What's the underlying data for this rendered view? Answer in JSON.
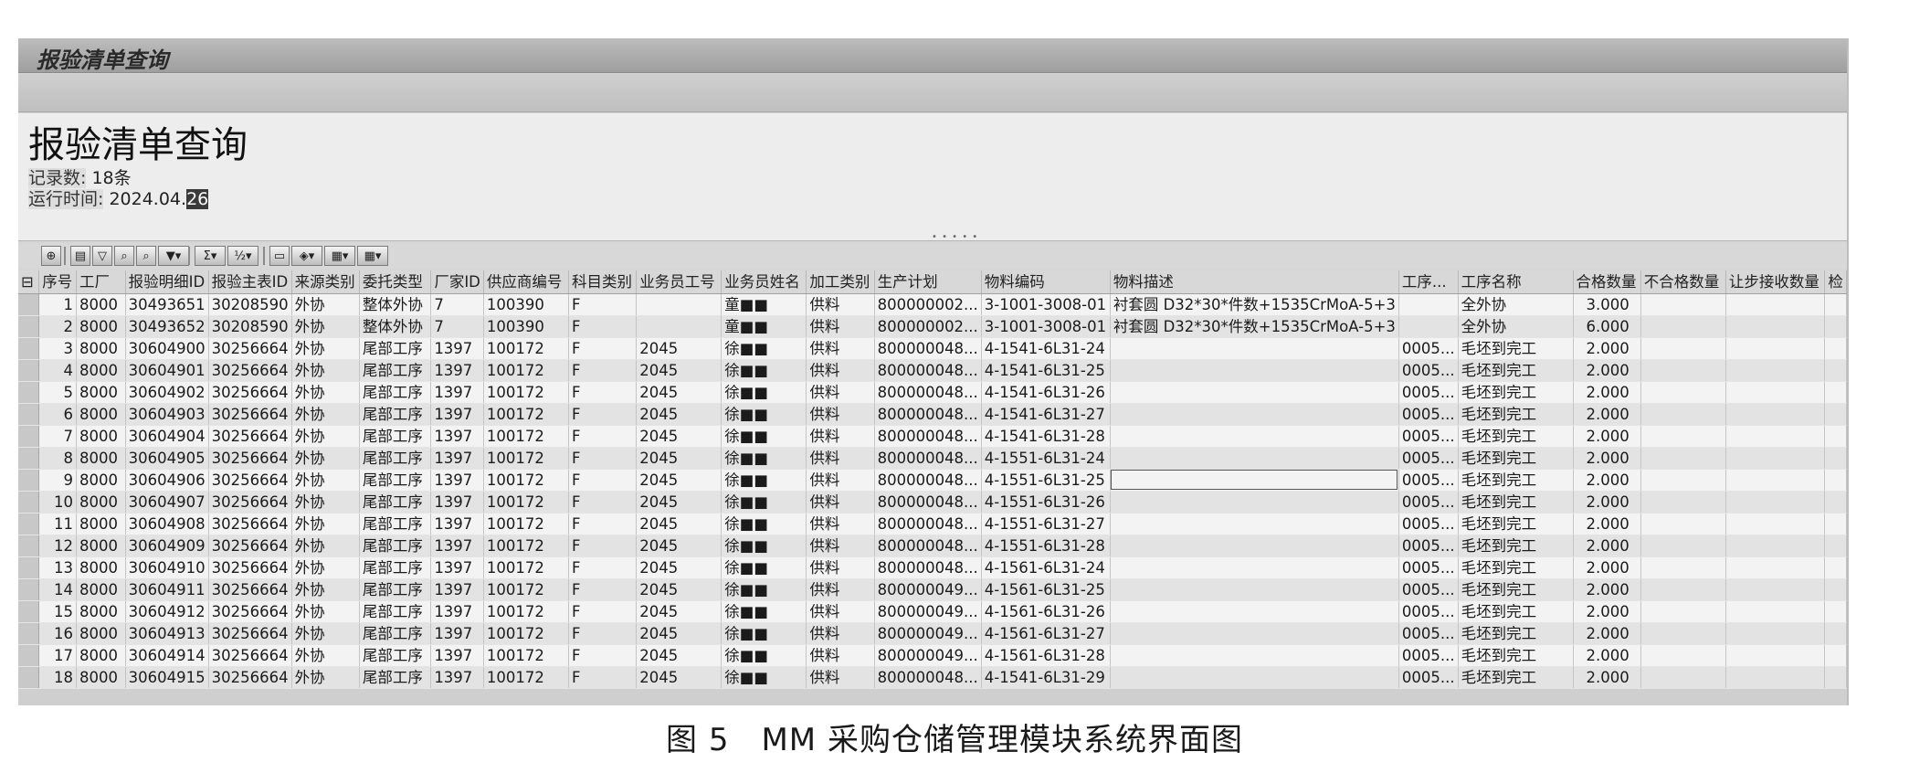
{
  "window": {
    "title": "报验清单查询"
  },
  "header": {
    "title": "报验清单查询",
    "count_label": "记录数:",
    "count_value": "18条",
    "time_label": "运行时间:",
    "time_value_prefix": "2024.04.",
    "time_value_selected": "26"
  },
  "toolbar": {
    "icons": [
      "details-icon",
      "print-icon",
      "filter-icon",
      "find-icon",
      "find-next-icon",
      "set-filter-icon",
      "sum-icon",
      "subtotal-icon",
      "print-preview-icon",
      "export-icon",
      "layout-icon",
      "select-layout-icon"
    ]
  },
  "table": {
    "columns": [
      "序号",
      "工厂",
      "报验明细ID",
      "报验主表ID",
      "来源类别",
      "委托类型",
      "厂家ID",
      "供应商编号",
      "科目类别",
      "业务员工号",
      "业务员姓名",
      "加工类别",
      "生产计划",
      "物料编码",
      "物料描述",
      "工序...",
      "工序名称",
      "合格数量",
      "不合格数量",
      "让步接收数量",
      "检"
    ],
    "rows": [
      [
        "1",
        "8000",
        "30493651",
        "30208590",
        "外协",
        "整体外协",
        "7",
        "100390",
        "F",
        "",
        "童■■",
        "供料",
        "800000002...",
        "3-1001-3008-01",
        "衬套圆 D32*30*件数+1535CrMoA-5+3",
        "",
        "全外协",
        "3.000",
        "",
        ""
      ],
      [
        "2",
        "8000",
        "30493652",
        "30208590",
        "外协",
        "整体外协",
        "7",
        "100390",
        "F",
        "",
        "童■■",
        "供料",
        "800000002...",
        "3-1001-3008-01",
        "衬套圆 D32*30*件数+1535CrMoA-5+3",
        "",
        "全外协",
        "6.000",
        "",
        ""
      ],
      [
        "3",
        "8000",
        "30604900",
        "30256664",
        "外协",
        "尾部工序",
        "1397",
        "100172",
        "F",
        "2045",
        "徐■■",
        "供料",
        "800000048...",
        "4-1541-6L31-24",
        "",
        "0005...",
        "毛坯到完工",
        "2.000",
        "",
        ""
      ],
      [
        "4",
        "8000",
        "30604901",
        "30256664",
        "外协",
        "尾部工序",
        "1397",
        "100172",
        "F",
        "2045",
        "徐■■",
        "供料",
        "800000048...",
        "4-1541-6L31-25",
        "",
        "0005...",
        "毛坯到完工",
        "2.000",
        "",
        ""
      ],
      [
        "5",
        "8000",
        "30604902",
        "30256664",
        "外协",
        "尾部工序",
        "1397",
        "100172",
        "F",
        "2045",
        "徐■■",
        "供料",
        "800000048...",
        "4-1541-6L31-26",
        "",
        "0005...",
        "毛坯到完工",
        "2.000",
        "",
        ""
      ],
      [
        "6",
        "8000",
        "30604903",
        "30256664",
        "外协",
        "尾部工序",
        "1397",
        "100172",
        "F",
        "2045",
        "徐■■",
        "供料",
        "800000048...",
        "4-1541-6L31-27",
        "",
        "0005...",
        "毛坯到完工",
        "2.000",
        "",
        ""
      ],
      [
        "7",
        "8000",
        "30604904",
        "30256664",
        "外协",
        "尾部工序",
        "1397",
        "100172",
        "F",
        "2045",
        "徐■■",
        "供料",
        "800000048...",
        "4-1541-6L31-28",
        "",
        "0005...",
        "毛坯到完工",
        "2.000",
        "",
        ""
      ],
      [
        "8",
        "8000",
        "30604905",
        "30256664",
        "外协",
        "尾部工序",
        "1397",
        "100172",
        "F",
        "2045",
        "徐■■",
        "供料",
        "800000048...",
        "4-1551-6L31-24",
        "",
        "0005...",
        "毛坯到完工",
        "2.000",
        "",
        ""
      ],
      [
        "9",
        "8000",
        "30604906",
        "30256664",
        "外协",
        "尾部工序",
        "1397",
        "100172",
        "F",
        "2045",
        "徐■■",
        "供料",
        "800000048...",
        "4-1551-6L31-25",
        "",
        "0005...",
        "毛坯到完工",
        "2.000",
        "",
        ""
      ],
      [
        "10",
        "8000",
        "30604907",
        "30256664",
        "外协",
        "尾部工序",
        "1397",
        "100172",
        "F",
        "2045",
        "徐■■",
        "供料",
        "800000048...",
        "4-1551-6L31-26",
        "",
        "0005...",
        "毛坯到完工",
        "2.000",
        "",
        ""
      ],
      [
        "11",
        "8000",
        "30604908",
        "30256664",
        "外协",
        "尾部工序",
        "1397",
        "100172",
        "F",
        "2045",
        "徐■■",
        "供料",
        "800000048...",
        "4-1551-6L31-27",
        "",
        "0005...",
        "毛坯到完工",
        "2.000",
        "",
        ""
      ],
      [
        "12",
        "8000",
        "30604909",
        "30256664",
        "外协",
        "尾部工序",
        "1397",
        "100172",
        "F",
        "2045",
        "徐■■",
        "供料",
        "800000048...",
        "4-1551-6L31-28",
        "",
        "0005...",
        "毛坯到完工",
        "2.000",
        "",
        ""
      ],
      [
        "13",
        "8000",
        "30604910",
        "30256664",
        "外协",
        "尾部工序",
        "1397",
        "100172",
        "F",
        "2045",
        "徐■■",
        "供料",
        "800000048...",
        "4-1561-6L31-24",
        "",
        "0005...",
        "毛坯到完工",
        "2.000",
        "",
        ""
      ],
      [
        "14",
        "8000",
        "30604911",
        "30256664",
        "外协",
        "尾部工序",
        "1397",
        "100172",
        "F",
        "2045",
        "徐■■",
        "供料",
        "800000049...",
        "4-1561-6L31-25",
        "",
        "0005...",
        "毛坯到完工",
        "2.000",
        "",
        ""
      ],
      [
        "15",
        "8000",
        "30604912",
        "30256664",
        "外协",
        "尾部工序",
        "1397",
        "100172",
        "F",
        "2045",
        "徐■■",
        "供料",
        "800000049...",
        "4-1561-6L31-26",
        "",
        "0005...",
        "毛坯到完工",
        "2.000",
        "",
        ""
      ],
      [
        "16",
        "8000",
        "30604913",
        "30256664",
        "外协",
        "尾部工序",
        "1397",
        "100172",
        "F",
        "2045",
        "徐■■",
        "供料",
        "800000049...",
        "4-1561-6L31-27",
        "",
        "0005...",
        "毛坯到完工",
        "2.000",
        "",
        ""
      ],
      [
        "17",
        "8000",
        "30604914",
        "30256664",
        "外协",
        "尾部工序",
        "1397",
        "100172",
        "F",
        "2045",
        "徐■■",
        "供料",
        "800000049...",
        "4-1561-6L31-28",
        "",
        "0005...",
        "毛坯到完工",
        "2.000",
        "",
        ""
      ],
      [
        "18",
        "8000",
        "30604915",
        "30256664",
        "外协",
        "尾部工序",
        "1397",
        "100172",
        "F",
        "2045",
        "徐■■",
        "供料",
        "800000048...",
        "4-1541-6L31-29",
        "",
        "0005...",
        "毛坯到完工",
        "2.000",
        "",
        ""
      ]
    ]
  },
  "caption": "图 5　MM 采购仓储管理模块系统界面图"
}
